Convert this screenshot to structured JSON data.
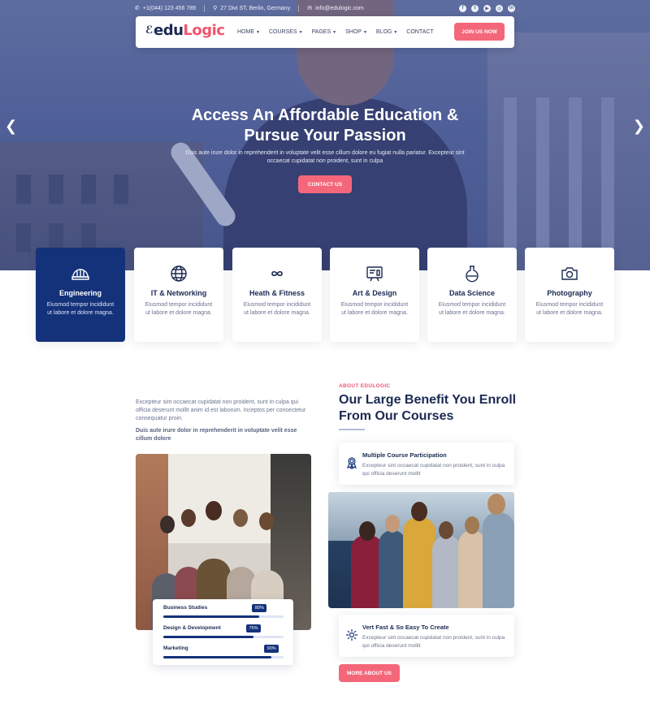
{
  "topbar": {
    "phone": "+1(044) 123 456 789",
    "address": "27 Divi ST, Berlin, Germany",
    "email": "info@edulogic.com",
    "social": [
      "facebook-icon",
      "twitter-icon",
      "youtube-icon",
      "instagram-icon",
      "linkedin-icon"
    ]
  },
  "brand": {
    "logo_main": "edu",
    "logo_accent": "Logic",
    "logo_cap_glyph": "ℰ"
  },
  "nav": {
    "items": [
      {
        "label": "HOME",
        "dropdown": true
      },
      {
        "label": "COURSES",
        "dropdown": true
      },
      {
        "label": "PAGES",
        "dropdown": true
      },
      {
        "label": "SHOP",
        "dropdown": true
      },
      {
        "label": "BLOG",
        "dropdown": true
      },
      {
        "label": "CONTACT",
        "dropdown": false
      }
    ],
    "cta": "JOIN US NOW"
  },
  "hero": {
    "title_line1": "Access An Affordable Education &",
    "title_line2": "Pursue Your Passion",
    "subtitle": "Duis aute irure dolor in reprehenderit in voluptate velit esse cillum dolore eu fugiat nulla pariatur. Excepteur sint occaecat cupidatat non proident, sunt in culpa",
    "cta": "CONTACT US",
    "prev_arrow": "❮",
    "next_arrow": "❯"
  },
  "categories": [
    {
      "title": "Engineering",
      "text": "Eiusmod tempor incididunt ut labore et dolore magna.",
      "icon": "helmet-icon",
      "active": true
    },
    {
      "title": "IT & Networking",
      "text": "Eiusmod tempor incididunt ut labore et dolore magna.",
      "icon": "globe-icon",
      "active": false
    },
    {
      "title": "Heath & Fitness",
      "text": "Eiusmod tempor incididunt ut labore et dolore magna.",
      "icon": "infinity-icon",
      "active": false
    },
    {
      "title": "Art & Design",
      "text": "Eiusmod tempor incididunt ut labore et dolore magna.",
      "icon": "design-board-icon",
      "active": false
    },
    {
      "title": "Data Science",
      "text": "Eiusmod tempor incididunt ut labore et dolore magna.",
      "icon": "flask-icon",
      "active": false
    },
    {
      "title": "Photography",
      "text": "Eiusmod tempor incididunt ut labore et dolore magna.",
      "icon": "camera-icon",
      "active": false
    }
  ],
  "about": {
    "para1": "Excepteur sint occaecat cupidatat non proident, sunt in culpa qui officia deserunt mollit anim id est laborum. Inceptos per consectetur consequatur proin.",
    "para2": "Duis aute irure dolor in reprehenderit in voluptate velit esse cillum dolore",
    "eyebrow": "ABOUT EDULOGIC",
    "title": "Our Large Benefit You Enroll From Our Courses",
    "skills": [
      {
        "label": "Business Studies",
        "value": 80,
        "badge": "80%"
      },
      {
        "label": "Design & Development",
        "value": 75,
        "badge": "75%"
      },
      {
        "label": "Marketing",
        "value": 90,
        "badge": "90%"
      }
    ],
    "features": [
      {
        "title": "Multiple Course Participation",
        "text": "Excepteur sint occaecat cupidatat non proident, sunt in culpa qui officia deserunt mollit",
        "icon": "award-ribbon-icon"
      },
      {
        "title": "Vert Fast & So Easy To Create",
        "text": "Excepteur sint occaecat cupidatat non proident, sunt in culpa qui officia deserunt mollit",
        "icon": "gear-icon"
      }
    ],
    "cta": "MORE ABOUT US"
  },
  "colors": {
    "primary": "#14327a",
    "accent": "#f4677a",
    "heading": "#1b2a52",
    "muted": "#6b7390"
  }
}
